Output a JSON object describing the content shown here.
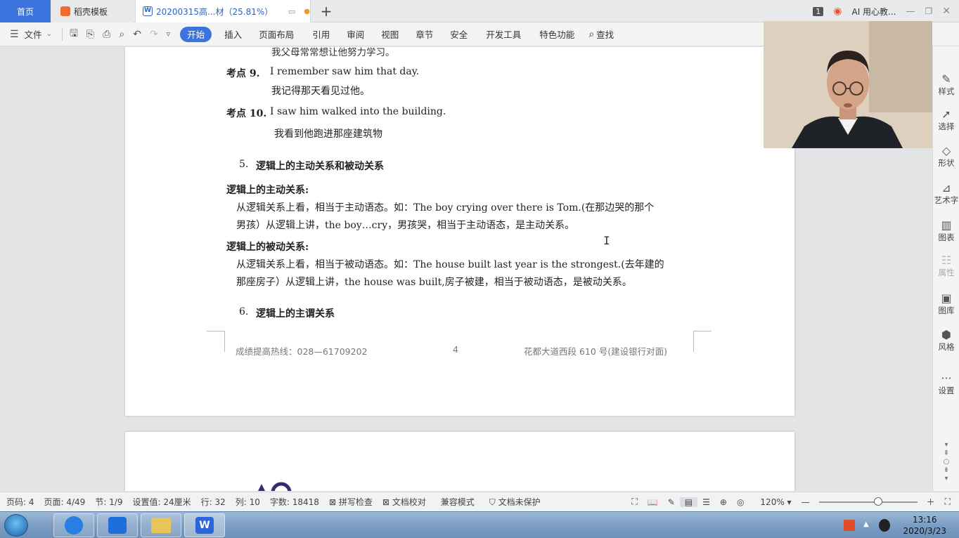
{
  "tabs": {
    "home": "首页",
    "template": "稻壳模板",
    "document": "20200315高...材（25.81%）",
    "new_tab": "+"
  },
  "top_right": {
    "badge": "1",
    "ai_label": "AI 用心教..."
  },
  "toolbar": {
    "file": "文件",
    "start": "开始",
    "insert": "插入",
    "layout": "页面布局",
    "reference": "引用",
    "review": "审阅",
    "view": "视图",
    "chapter": "章节",
    "security": "安全",
    "dev": "开发工具",
    "features": "特色功能",
    "search": "查找"
  },
  "document": {
    "top_cut": "我父母常常想让他努力学习。",
    "item9_label": "考点 9.",
    "item9_en": "I remember saw him that day.",
    "item9_cn": "我记得那天看见过他。",
    "item10_label": "考点 10.",
    "item10_en": "I saw him walked into the building.",
    "item10_cn": "我看到他跑进那座建筑物",
    "section5_num": "5.",
    "section5_title": "逻辑上的主动关系和被动关系",
    "active_heading": "逻辑上的主动关系:",
    "active_line1": "从逻辑关系上看，相当于主动语态。如：The boy crying over there is Tom.(在那边哭的那个",
    "active_line2": "男孩）从逻辑上讲，the boy…cry，男孩哭，相当于主动语态，是主动关系。",
    "passive_heading": "逻辑上的被动关系:",
    "passive_line1": "从逻辑关系上看，相当于被动语态。如：The house built last year is the strongest.(去年建的",
    "passive_line2": "那座房子）从逻辑上讲，the house was built,房子被建，相当于被动语态，是被动关系。",
    "section6_num": "6.",
    "section6_title": "逻辑上的主谓关系",
    "footer_left": "成绩提高热线：028—61709202",
    "footer_page": "4",
    "footer_right": "花都大道西段 610 号(建设银行对面)"
  },
  "side_panel": {
    "style": "样式",
    "select": "选择",
    "shape": "形状",
    "art": "艺术字",
    "chart": "图表",
    "props": "属性",
    "library": "图库",
    "theme": "风格",
    "settings": "设置"
  },
  "status": {
    "page_code": "页码: 4",
    "page": "页面: 4/49",
    "section": "节: 1/9",
    "setting": "设置值: 24厘米",
    "row": "行: 32",
    "col": "列: 10",
    "words": "字数: 18418",
    "spell": "拼写检查",
    "proof": "文档校对",
    "compat": "兼容模式",
    "protect": "文档未保护",
    "zoom": "120%",
    "zoom_level": 0.6
  },
  "taskbar": {
    "time": "13:16",
    "date": "2020/3/23"
  }
}
